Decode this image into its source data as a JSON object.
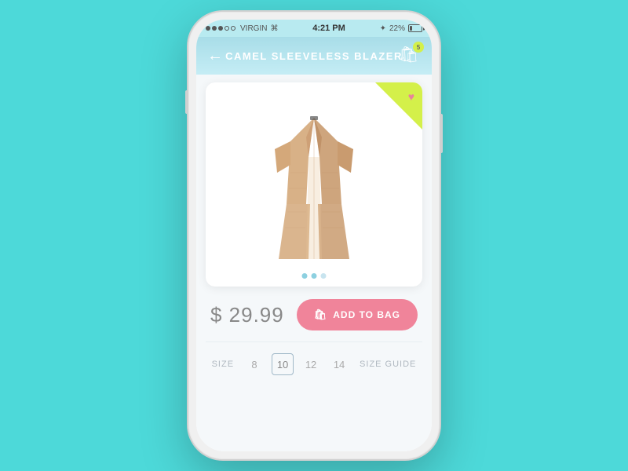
{
  "status_bar": {
    "carrier": "VIRGIN",
    "time": "4:21 PM",
    "battery_percent": "22%"
  },
  "header": {
    "title": "CAMEL SLEEVELESS BLAZER",
    "back_label": "←",
    "cart_count": "5"
  },
  "product": {
    "price": "$ 29.99",
    "add_to_bag_label": "ADD TO BAG",
    "favorite_icon": "♥",
    "bag_icon": "🛍"
  },
  "size": {
    "label": "SIZE",
    "options": [
      "8",
      "10",
      "12",
      "14"
    ],
    "selected": "10",
    "guide_label": "SIZE GUIDE"
  },
  "dots": [
    {
      "active": true
    },
    {
      "active": true
    },
    {
      "active": false
    }
  ],
  "icons": {
    "back_arrow": "←",
    "heart": "♥",
    "shopping_bag": "🛍",
    "bluetooth": "⚡"
  }
}
